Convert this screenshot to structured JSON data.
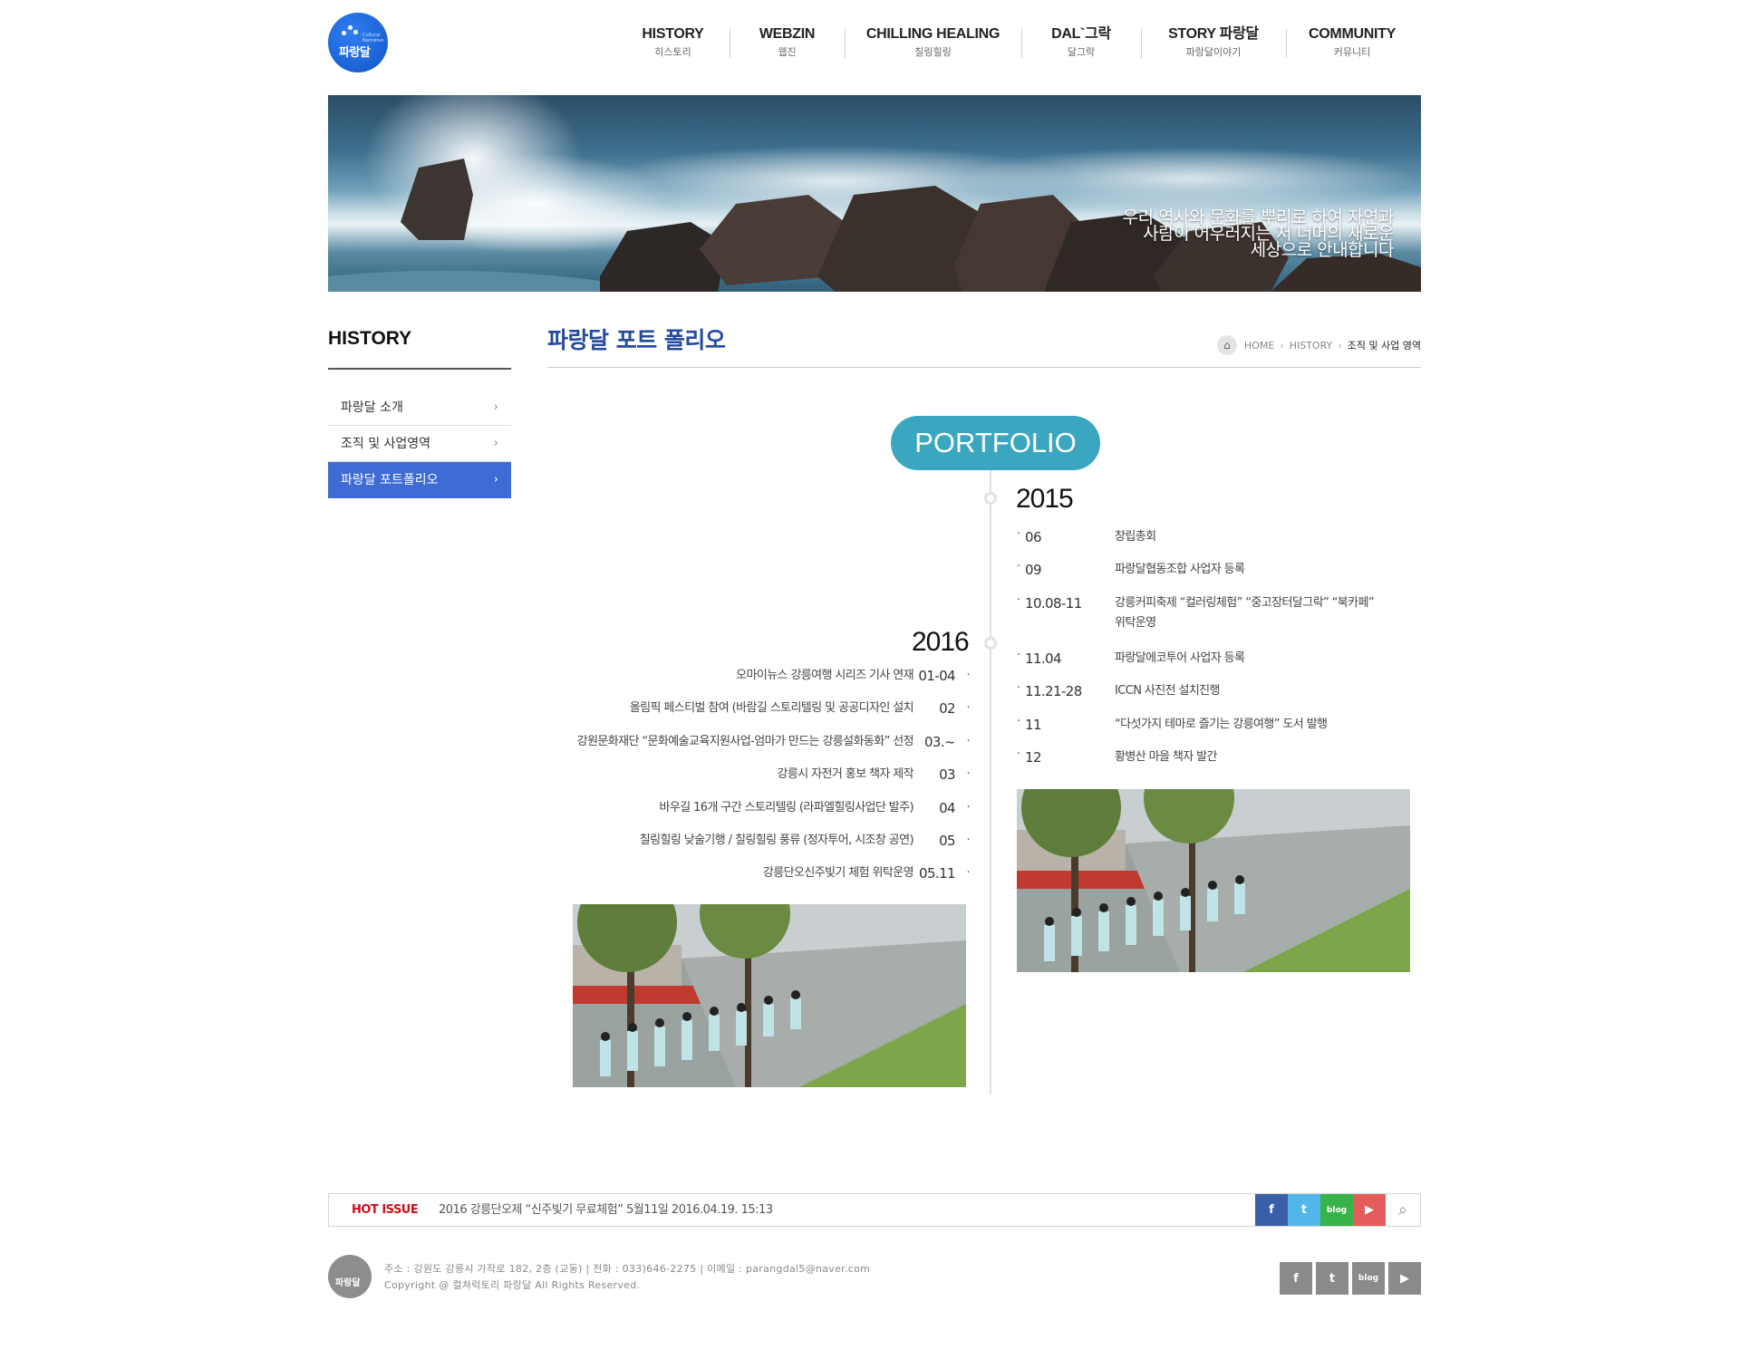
{
  "brand": {
    "logo_text": "파랑달",
    "logo_sub": "Cultural Narrative"
  },
  "gnb": [
    {
      "en": "HISTORY",
      "ko": "히스토리"
    },
    {
      "en": "WEBZIN",
      "ko": "웹진"
    },
    {
      "en": "CHILLING HEALING",
      "ko": "칠링힐링"
    },
    {
      "en": "DAL`그락",
      "ko": "달그락"
    },
    {
      "en": "STORY 파랑달",
      "ko": "파랑달이야기"
    },
    {
      "en": "COMMUNITY",
      "ko": "커뮤니티"
    }
  ],
  "banner": {
    "line1": "우리 역사와 문화를 뿌리로 하여 자연과",
    "line2": "사람이 어우러지는 저 너머의 새로운",
    "line3": "세상으로 안내합니다"
  },
  "lnb": {
    "title": "HISTORY",
    "items": [
      {
        "label": "파랑달 소개"
      },
      {
        "label": "조직 및 사업영역"
      },
      {
        "label": "파랑달 포트폴리오"
      }
    ]
  },
  "page": {
    "title": "파랑달 포트 폴리오",
    "breadcrumb": {
      "home": "HOME",
      "section": "HISTORY",
      "current": "조직 및 사업 영역"
    }
  },
  "timeline": {
    "badge": "PORTFOLIO",
    "y2015": {
      "year": "2015",
      "events": [
        {
          "date": "06",
          "desc": "창립총회"
        },
        {
          "date": "09",
          "desc": "파랑달협동조합 사업자 등록"
        },
        {
          "date": "10.08-11",
          "desc": "강릉커피축제 “컬러링체험” “중고장터달그락” “북카페”",
          "desc2": "위탁운영"
        },
        {
          "date": "11.04",
          "desc": "파랑달에코투어 사업자 등록"
        },
        {
          "date": "11.21-28",
          "desc": "ICCN 사진전 설치진행"
        },
        {
          "date": "11",
          "desc": "“다섯가지 테마로 즐기는 강릉여행” 도서 발행"
        },
        {
          "date": "12",
          "desc": "황병산 마을 책자 발간"
        }
      ]
    },
    "y2016": {
      "year": "2016",
      "events": [
        {
          "date": "01-04",
          "desc": "오마이뉴스 강릉여행 시리즈 기사 연재"
        },
        {
          "date": "02",
          "desc": "올림픽 페스티벌 참여 (바람길 스토리텔링 및 공공디자인 설치"
        },
        {
          "date": "03.~",
          "desc": "강원문화재단 “문화예술교육지원사업-엄마가 만드는 강릉설화동화” 선정"
        },
        {
          "date": "03",
          "desc": "강릉시 자전거 홍보 책자 제작"
        },
        {
          "date": "04",
          "desc": "바우길 16개 구간 스토리텔링 (라파엘힐링사업단 발주)"
        },
        {
          "date": "05",
          "desc": "칠링힐링 낮술기행 / 칠링힐링 풍류 (정자투어, 시조창 공연)"
        },
        {
          "date": "05.11",
          "desc": "강릉단오신주빚기 체험 위탁운영"
        }
      ]
    },
    "bullet": "·"
  },
  "footer": {
    "hot_label": "HOT ISSUE",
    "hot_text": "2016 강릉단오제 “신주빚기 무료체험” 5월11일 2016.04.19. 15:13",
    "address": "주소 : 강원도 강릉시 가작로 182, 2층 (교동) | 전화 : 033)646-2275  | 이메일 : parangdal5@naver.com",
    "copyright": "Copyright @ 컬쳐럭토리 파랑달 All Rights Reserved.",
    "sns": {
      "fb": "f",
      "tw": "t",
      "blog": "blog",
      "yt": "▶",
      "search": "⌕"
    },
    "icons": [
      "facebook-icon",
      "twitter-icon",
      "blog-icon",
      "youtube-icon",
      "search-icon"
    ]
  },
  "colors": {
    "accent": "#3f6bd4",
    "title": "#254b9e",
    "badge": "#3aa6c0",
    "hot": "#c9121b"
  }
}
